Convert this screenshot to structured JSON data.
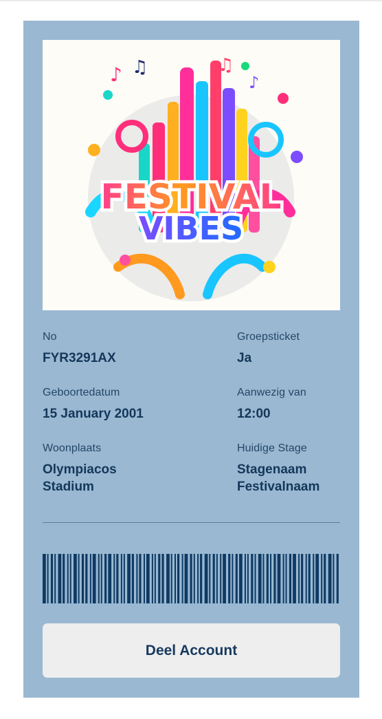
{
  "poster": {
    "title_line1": "FESTIVAL",
    "title_line2": "VIBES"
  },
  "fields": {
    "number": {
      "label": "No",
      "value": "FYR3291AX"
    },
    "group_ticket": {
      "label": "Groepsticket",
      "value": "Ja"
    },
    "birthdate": {
      "label": "Geboortedatum",
      "value": "15 January 2001"
    },
    "present_from": {
      "label": "Aanwezig van",
      "value": "12:00"
    },
    "residence": {
      "label": "Woonplaats",
      "value_line1": "Olympiacos",
      "value_line2": "Stadium"
    },
    "current_stage": {
      "label": "Huidige Stage",
      "value_line1": "Stagenaam",
      "value_line2": "Festivalnaam"
    }
  },
  "share_button": {
    "label": "Deel Account"
  },
  "colors": {
    "ticket_bg": "#9ab8d2",
    "text_dark": "#14375a",
    "barcode": "#0e3a63",
    "button_bg": "#eeeeee"
  },
  "barcode_pattern": [
    3,
    1,
    2,
    1,
    3,
    2,
    1,
    1,
    3,
    1,
    2,
    2,
    1,
    3,
    1,
    1,
    2,
    3,
    1,
    2,
    1,
    1,
    3,
    2,
    1,
    2,
    1,
    3,
    1,
    1,
    2,
    2,
    3,
    1,
    1,
    2,
    1,
    3,
    2,
    1,
    1,
    2,
    3,
    1,
    2,
    1,
    1,
    3,
    2,
    1,
    2,
    3,
    1,
    1,
    2,
    1,
    3,
    1,
    2,
    1,
    2,
    3,
    1,
    1,
    2,
    3,
    1,
    2,
    1,
    2,
    1,
    3,
    1,
    2,
    3,
    1,
    2
  ]
}
